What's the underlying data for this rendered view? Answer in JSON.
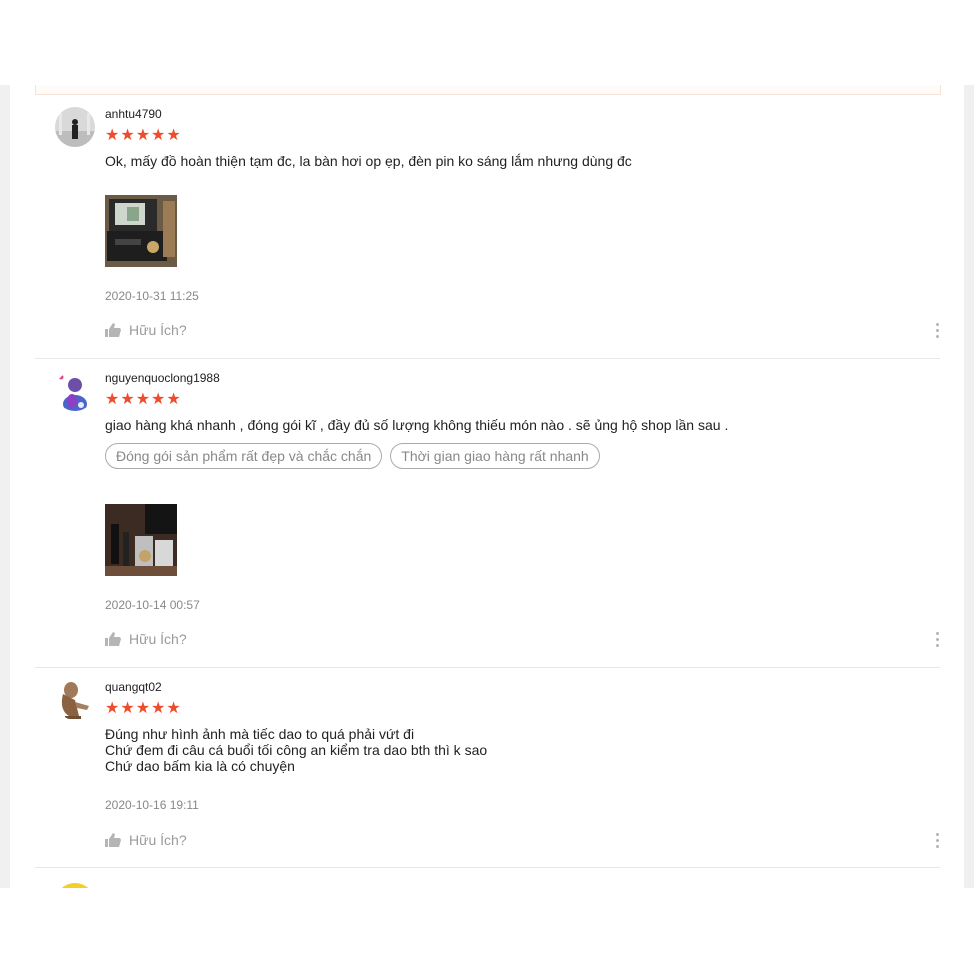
{
  "reviews": [
    {
      "username": "anhtu4790",
      "rating": 5,
      "comment_lines": [
        "Ok, mấy đồ hoàn thiện tạm đc, la bàn hơi op ẹp, đèn pin ko sáng lắm nhưng dùng đc"
      ],
      "tags": [],
      "date": "2020-10-31 11:25",
      "helpful_label": "Hữu Ích?"
    },
    {
      "username": "nguyenquoclong1988",
      "rating": 5,
      "comment_lines": [
        "giao hàng khá nhanh , đóng gói kĩ , đầy đủ số lượng không thiếu món nào . sẽ ủng hộ shop lần sau ."
      ],
      "tags": [
        "Đóng gói sản phẩm rất đẹp và chắc chắn",
        "Thời gian giao hàng rất nhanh"
      ],
      "date": "2020-10-14 00:57",
      "helpful_label": "Hữu Ích?"
    },
    {
      "username": "quangqt02",
      "rating": 5,
      "comment_lines": [
        "Đúng như hình ảnh mà tiếc dao to quá phải vứt đi",
        "Chứ đem đi câu cá buổi tối công an kiểm tra dao bth thì k sao",
        "Chứ dao bấm kia là có chuyện"
      ],
      "tags": [],
      "date": "2020-10-16 19:11",
      "helpful_label": "Hữu Ích?"
    }
  ],
  "icons": {
    "star": "★",
    "helpful": "thumbs-up-icon",
    "more": "more-vertical-icon"
  },
  "colors": {
    "star": "#ee4d2d",
    "muted": "#888888"
  }
}
